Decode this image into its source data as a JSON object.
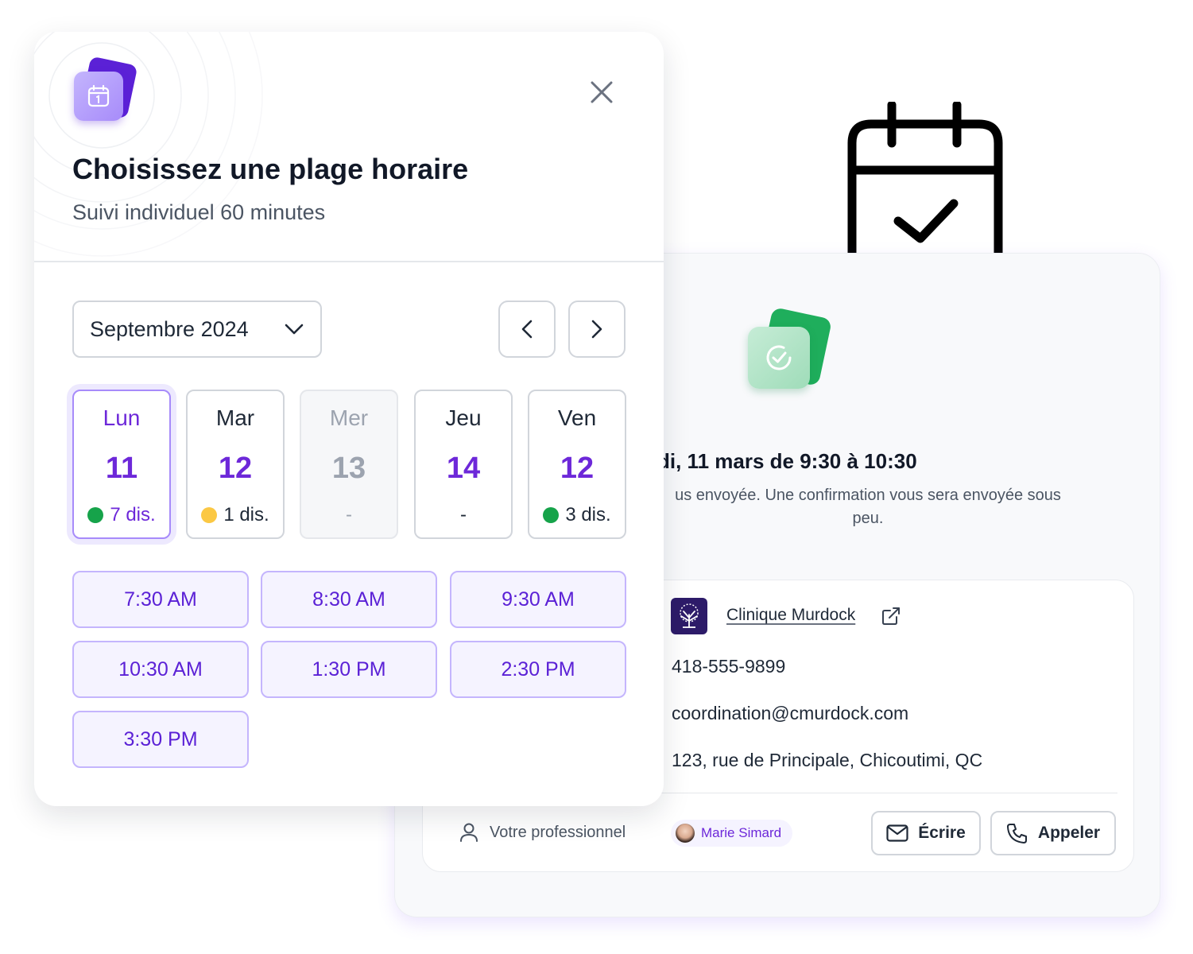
{
  "scheduler": {
    "title": "Choisissez une plage horaire",
    "subtitle": "Suivi individuel 60 minutes",
    "month_select": "Septembre 2024",
    "days": [
      {
        "name": "Lun",
        "number": "11",
        "availability": "7 dis.",
        "dot": "#16a34a",
        "state": "selected"
      },
      {
        "name": "Mar",
        "number": "12",
        "availability": "1 dis.",
        "dot": "#fbc844",
        "state": "normal"
      },
      {
        "name": "Mer",
        "number": "13",
        "availability": "-",
        "dot": "",
        "state": "disabled"
      },
      {
        "name": "Jeu",
        "number": "14",
        "availability": "-",
        "dot": "",
        "state": "normal"
      },
      {
        "name": "Ven",
        "number": "12",
        "availability": "3 dis.",
        "dot": "#16a34a",
        "state": "normal"
      }
    ],
    "slots": [
      "7:30 AM",
      "8:30 AM",
      "9:30 AM",
      "10:30 AM",
      "1:30 PM",
      "2:30 PM",
      "3:30 PM"
    ]
  },
  "confirmation": {
    "title": "di, 11 mars de 9:30 à 10:30",
    "description": "us envoyée. Une confirmation vous sera envoyée sous peu.",
    "clinic_name": "Clinique Murdock",
    "phone": "418-555-9899",
    "email": "coordination@cmurdock.com",
    "address": "123, rue de Principale, Chicoutimi, QC",
    "professional_label": "Votre professionnel",
    "professional_name": "Marie Simard",
    "write_label": "Écrire",
    "call_label": "Appeler"
  },
  "colors": {
    "accent": "#6d28d9",
    "slot_bg": "#f5f3ff",
    "success": "#16a34a",
    "warning": "#fbc844"
  },
  "icons": [
    "calendar-check-icon",
    "calendar-icon",
    "close-icon",
    "chevron-down-icon",
    "chevron-left-icon",
    "chevron-right-icon",
    "check-circle-icon",
    "external-link-icon",
    "user-icon",
    "mail-icon",
    "phone-icon",
    "tree-logo-icon"
  ]
}
